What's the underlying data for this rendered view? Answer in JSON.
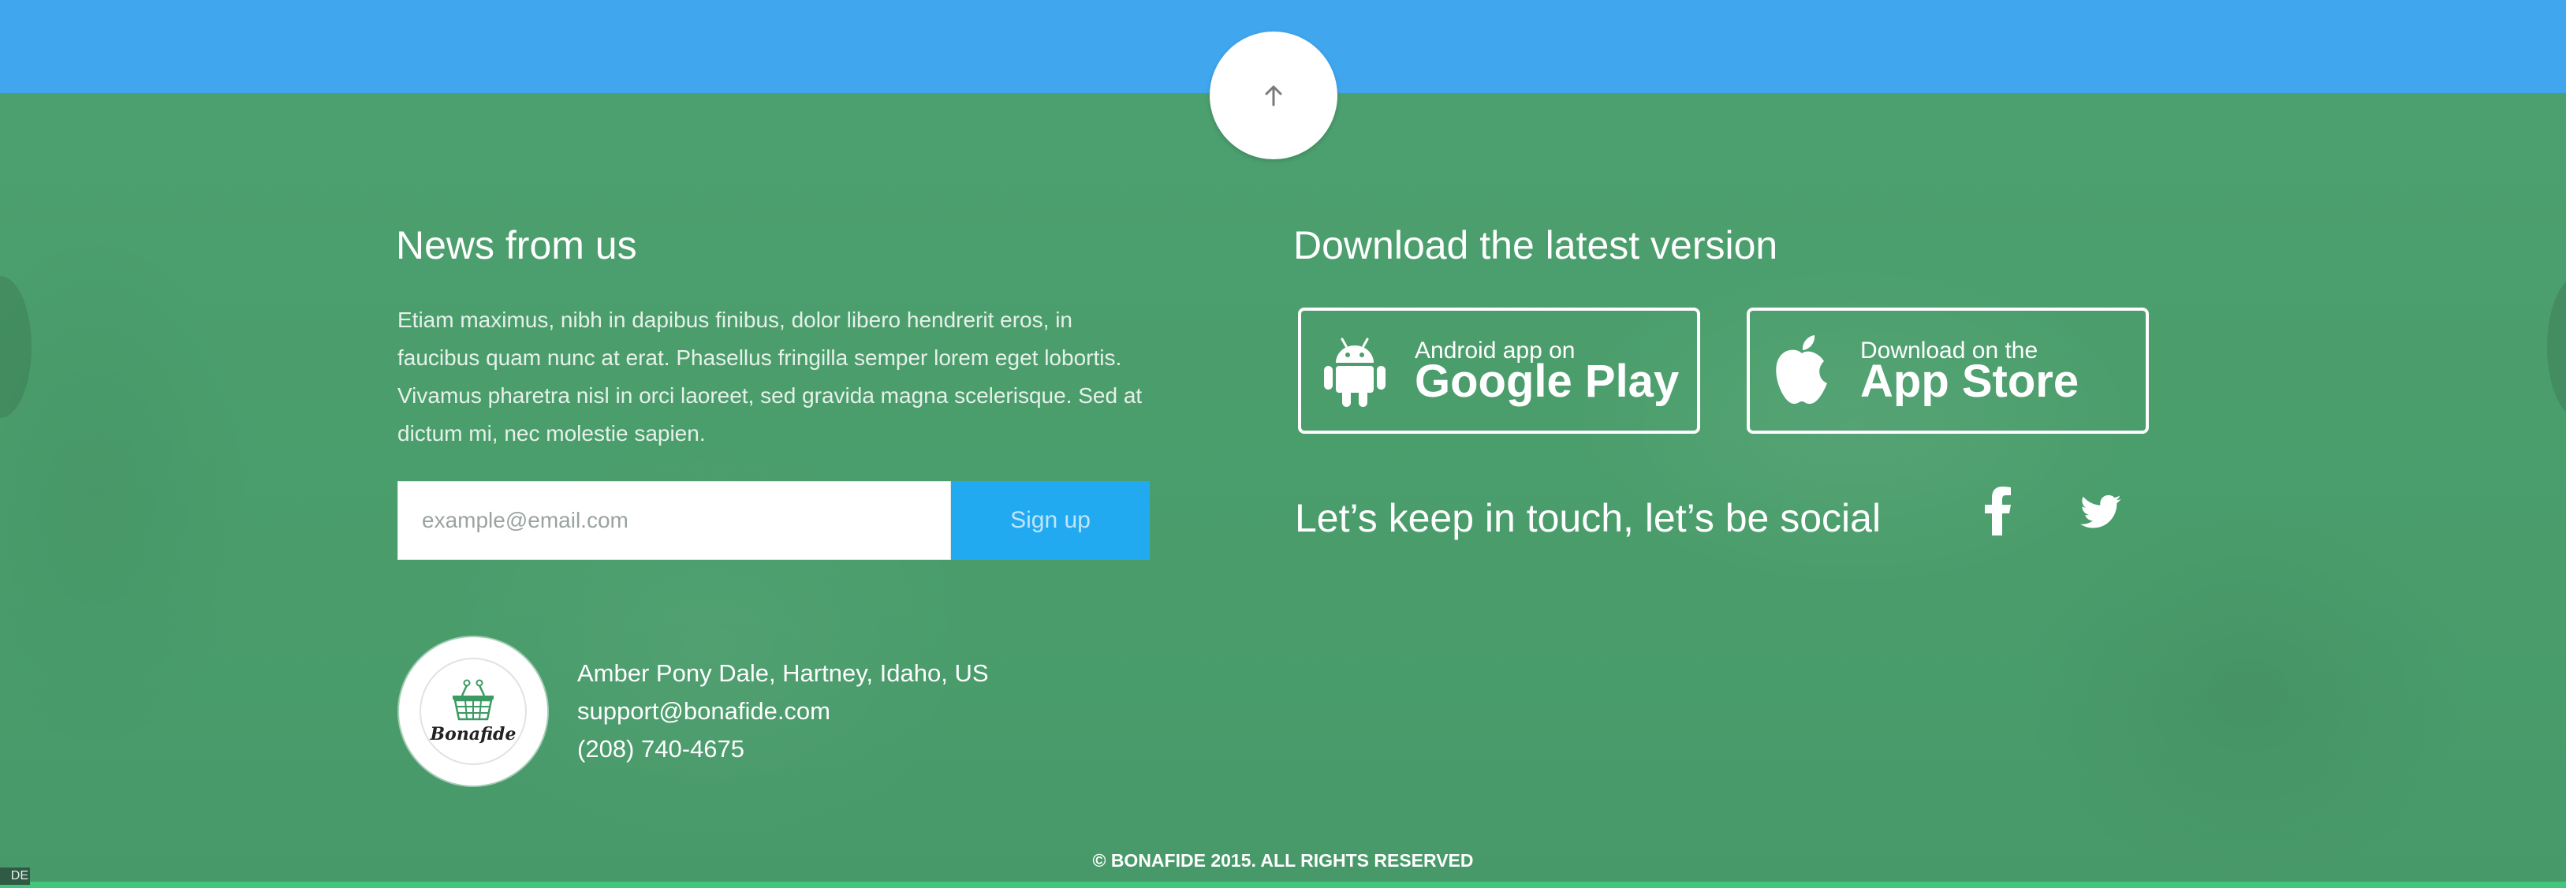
{
  "scroll_top": {
    "icon": "arrow-up-icon"
  },
  "news": {
    "title": "News from us",
    "text": "Etiam maximus, nibh in dapibus finibus, dolor libero hendrerit eros, in faucibus quam nunc at erat. Phasellus fringilla semper lorem eget lobortis. Vivamus pharetra nisl in orci laoreet, sed gravida magna scelerisque. Sed at dictum mi, nec molestie sapien.",
    "email_placeholder": "example@email.com",
    "email_value": "",
    "signup_label": "Sign up"
  },
  "download": {
    "title": "Download the latest version",
    "google_play": {
      "small": "Android app on",
      "big": "Google Play",
      "icon": "android-icon"
    },
    "app_store": {
      "small": "Download on the",
      "big": "App Store",
      "icon": "apple-icon"
    }
  },
  "social": {
    "text": "Let’s keep in touch, let’s be social",
    "icons": [
      "facebook-icon",
      "twitter-icon"
    ]
  },
  "contact": {
    "logo_text": "Bonafide",
    "address": "Amber Pony Dale, Hartney, Idaho, US",
    "email": "support@bonafide.com",
    "phone": "(208) 740-4675"
  },
  "copyright": "© BONAFIDE 2015. ALL RIGHTS RESERVED",
  "edge_tag": "DE",
  "colors": {
    "top_bar": "#40a6ee",
    "footer_green": "#4a9f6c",
    "signup_blue": "#22aaf1",
    "bottom_strip": "#43c67b"
  }
}
